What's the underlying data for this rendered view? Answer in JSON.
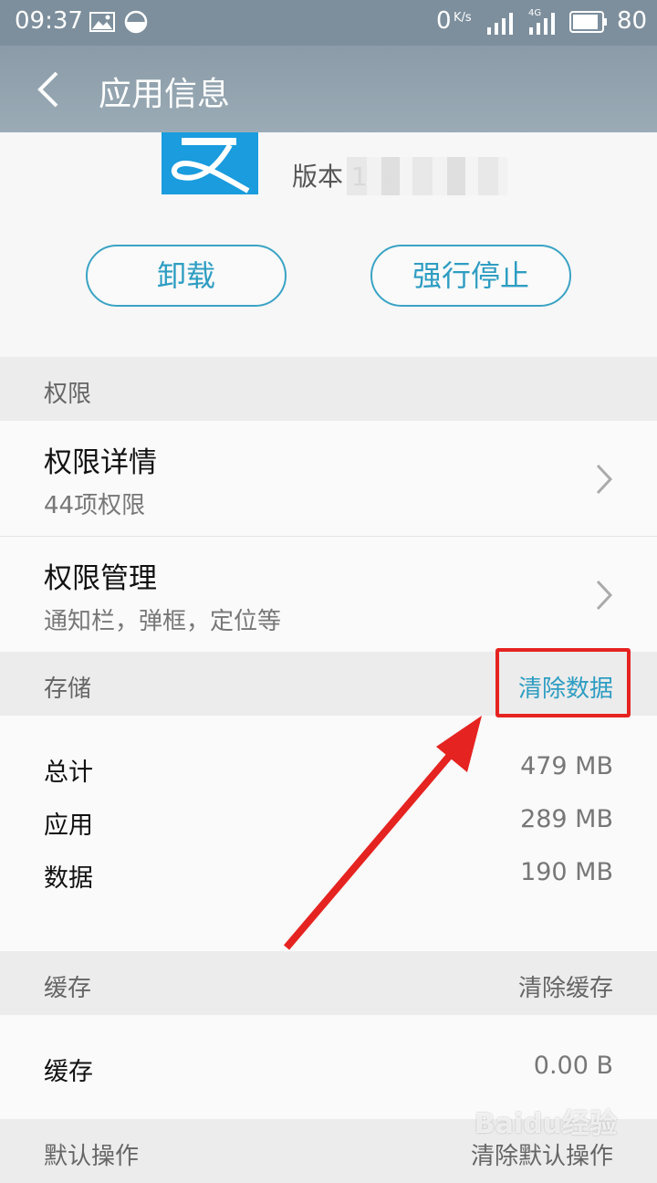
{
  "status_bar": {
    "time": "09:37",
    "network_speed": "0",
    "network_speed_unit": "K/s",
    "network_type": "4G",
    "battery": "80"
  },
  "title_bar": {
    "title": "应用信息"
  },
  "app": {
    "version_label": "版本 1",
    "icon_color": "#1a9cde"
  },
  "buttons": {
    "uninstall": "卸载",
    "force_stop": "强行停止"
  },
  "permissions": {
    "section_label": "权限",
    "items": [
      {
        "title": "权限详情",
        "subtitle": "44项权限"
      },
      {
        "title": "权限管理",
        "subtitle": "通知栏，弹框，定位等"
      }
    ]
  },
  "storage": {
    "section_label": "存储",
    "action": "清除数据",
    "rows": [
      {
        "label": "总计",
        "value": "479 MB"
      },
      {
        "label": "应用",
        "value": "289 MB"
      },
      {
        "label": "数据",
        "value": "190 MB"
      }
    ]
  },
  "cache": {
    "section_label": "缓存",
    "action": "清除缓存",
    "row_label": "缓存",
    "row_value": "0.00 B"
  },
  "default_actions": {
    "section_label": "默认操作",
    "action": "清除默认操作"
  },
  "watermark": "Baidu经验",
  "colors": {
    "accent": "#2e9dc2",
    "highlight": "#e52320",
    "title_bar": "#8b9ca8"
  }
}
